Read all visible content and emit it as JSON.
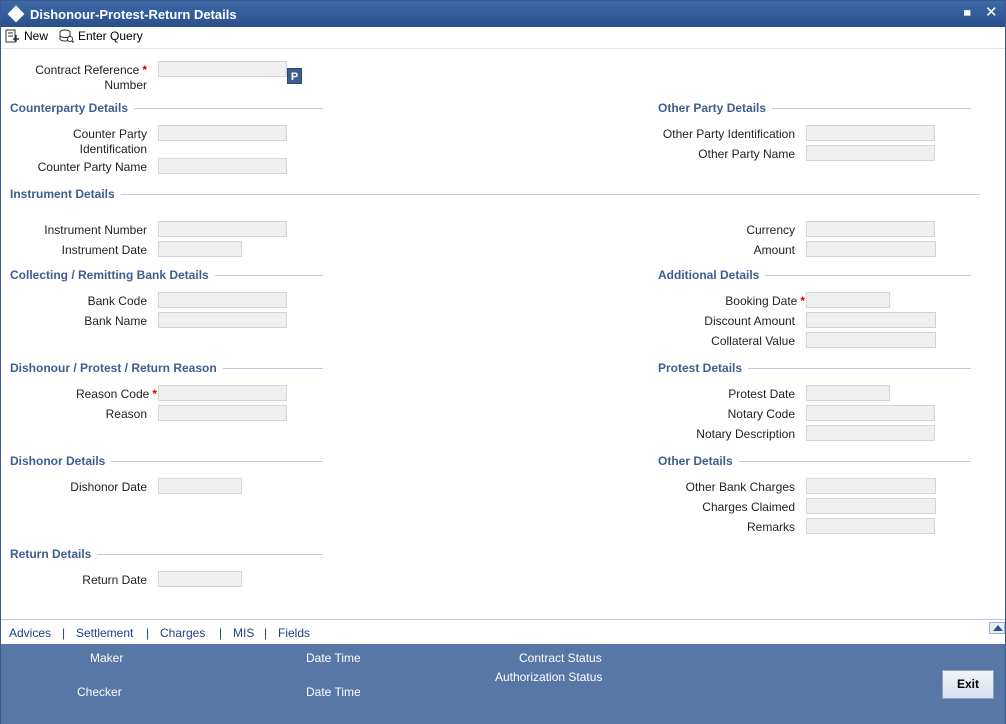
{
  "window": {
    "title": "Dishonour-Protest-Return Details",
    "minimize": "▄",
    "close": "✕"
  },
  "toolbar": {
    "new_label": "New",
    "enter_query_label": "Enter Query"
  },
  "form": {
    "contract_reference_line1": "Contract Reference",
    "contract_reference_line2": "Number",
    "required_mark": "*",
    "p_button": "P",
    "sections": {
      "counterparty": "Counterparty Details",
      "other_party": "Other Party Details",
      "instrument": "Instrument Details",
      "collecting_bank": "Collecting / Remitting Bank Details",
      "additional": "Additional Details",
      "reason": "Dishonour / Protest / Return Reason",
      "protest": "Protest Details",
      "dishonor": "Dishonor Details",
      "other": "Other Details",
      "return": "Return Details"
    },
    "labels": {
      "counter_party_id_line1": "Counter Party",
      "counter_party_id_line2": "Identification",
      "counter_party_name": "Counter Party Name",
      "other_party_id": "Other Party Identification",
      "other_party_name": "Other Party Name",
      "instrument_number": "Instrument Number",
      "instrument_date": "Instrument Date",
      "currency": "Currency",
      "amount": "Amount",
      "bank_code": "Bank Code",
      "bank_name": "Bank Name",
      "booking_date": "Booking Date",
      "discount_amount": "Discount Amount",
      "collateral_value": "Collateral Value",
      "reason_code": "Reason Code",
      "reason": "Reason",
      "protest_date": "Protest Date",
      "notary_code": "Notary Code",
      "notary_description": "Notary Description",
      "dishonor_date": "Dishonor Date",
      "other_bank_charges": "Other Bank Charges",
      "charges_claimed": "Charges Claimed",
      "remarks": "Remarks",
      "return_date": "Return Date"
    }
  },
  "tabs": [
    "Advices",
    "Settlement",
    "Charges",
    "MIS",
    "Fields"
  ],
  "tab_separator": "|",
  "status": {
    "maker": "Maker",
    "checker": "Checker",
    "date_time": "Date Time",
    "contract_status": "Contract Status",
    "authorization_status": "Authorization Status",
    "exit": "Exit"
  }
}
